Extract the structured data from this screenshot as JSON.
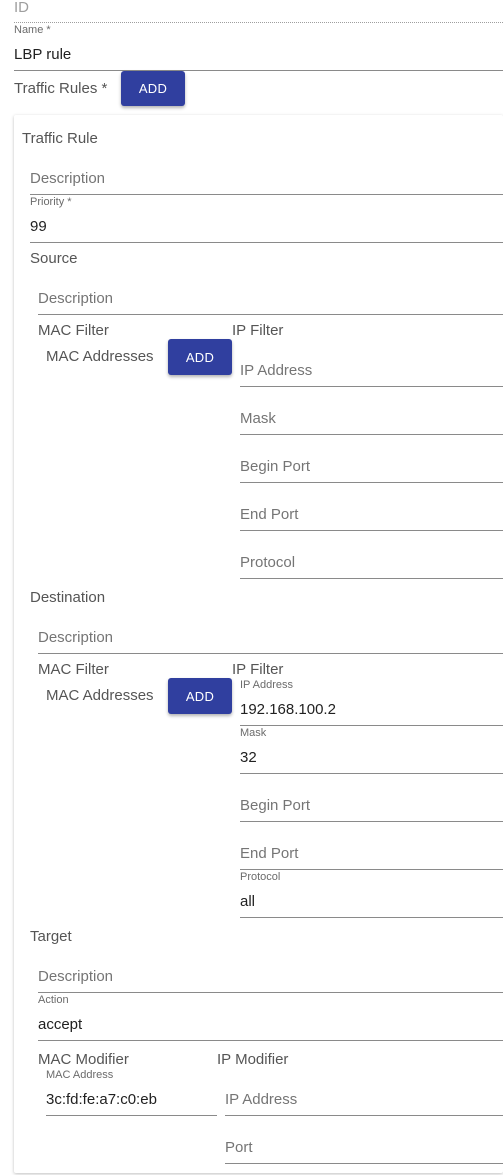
{
  "top": {
    "id_placeholder": "ID",
    "name_label": "Name *",
    "name_value": "LBP rule",
    "traffic_rules_label": "Traffic Rules *",
    "add_label": "ADD"
  },
  "rule": {
    "title": "Traffic Rule",
    "description_placeholder": "Description",
    "priority_label": "Priority *",
    "priority_value": "99",
    "source": {
      "title": "Source",
      "description_placeholder": "Description",
      "mac_filter_title": "MAC Filter",
      "mac_addresses_label": "MAC Addresses",
      "add_label": "ADD",
      "ip_filter_title": "IP Filter",
      "ip_address_placeholder": "IP Address",
      "mask_placeholder": "Mask",
      "begin_port_placeholder": "Begin Port",
      "end_port_placeholder": "End Port",
      "protocol_placeholder": "Protocol"
    },
    "destination": {
      "title": "Destination",
      "description_placeholder": "Description",
      "mac_filter_title": "MAC Filter",
      "mac_addresses_label": "MAC Addresses",
      "add_label": "ADD",
      "ip_filter_title": "IP Filter",
      "ip_address_label": "IP Address",
      "ip_address_value": "192.168.100.2",
      "mask_label": "Mask",
      "mask_value": "32",
      "begin_port_placeholder": "Begin Port",
      "end_port_placeholder": "End Port",
      "protocol_label": "Protocol",
      "protocol_value": "all"
    },
    "target": {
      "title": "Target",
      "description_placeholder": "Description",
      "action_label": "Action",
      "action_value": "accept",
      "mac_modifier_title": "MAC Modifier",
      "mac_address_label": "MAC Address",
      "mac_address_value": "3c:fd:fe:a7:c0:eb",
      "ip_modifier_title": "IP Modifier",
      "ip_address_placeholder": "IP Address",
      "port_placeholder": "Port"
    }
  }
}
